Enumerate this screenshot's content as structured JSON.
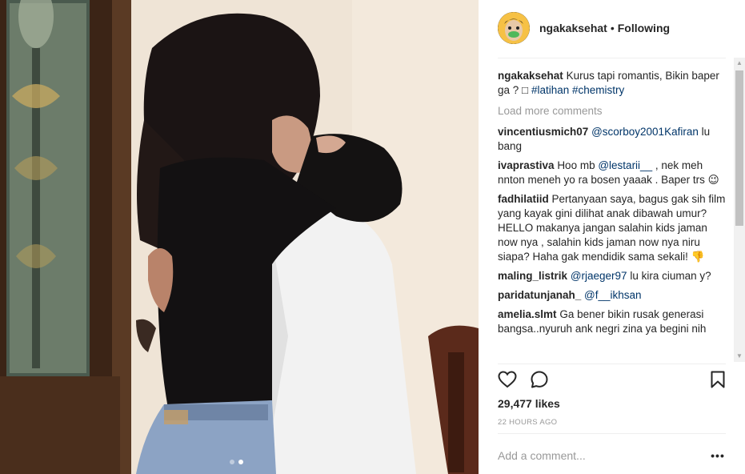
{
  "post": {
    "username": "ngakaksehat",
    "separator": "•",
    "follow_status": "Following",
    "caption": {
      "user": "ngakaksehat",
      "text": "Kurus tapi romantis, Bikin baper ga ? □ ",
      "hashtag1": "#latihan",
      "hashtag2": "#chemistry"
    },
    "load_more": "Load more comments",
    "comments": [
      {
        "user": "vincentiusmich07",
        "mention": "@scorboy2001Kafiran",
        "text_after": " lu bang"
      },
      {
        "user": "ivaprastiva",
        "text_before": "Hoo mb ",
        "mention": "@lestarii__",
        "text_after": " , nek meh nnton meneh yo ra bosen yaaak . Baper trs 😉"
      },
      {
        "user": "fadhilatiid",
        "text": "Pertanyaan saya, bagus gak sih film yang kayak gini dilihat anak dibawah umur? HELLO makanya jangan salahin kids jaman now nya , salahin kids jaman now nya niru siapa? Haha gak mendidik sama sekali! 👎"
      },
      {
        "user": "maling_listrik",
        "mention": "@rjaeger97",
        "text_after": " lu kira ciuman y?"
      },
      {
        "user": "paridatunjanah_",
        "mention": "@f__ikhsan"
      },
      {
        "user": "amelia.slmt",
        "text": "Ga bener bikin rusak generasi bangsa..nyuruh ank negri zina ya begini nih"
      }
    ],
    "likes": "29,477 likes",
    "time": "22 HOURS AGO",
    "add_comment_placeholder": "Add a comment...",
    "more_options": "•••"
  },
  "icons": {
    "like": "heart-icon",
    "comment": "comment-bubble-icon",
    "save": "bookmark-icon",
    "more": "more-options-icon",
    "scroll_up": "scroll-up-arrow-icon",
    "scroll_down": "scroll-down-arrow-icon"
  },
  "colors": {
    "text": "#262626",
    "muted": "#999999",
    "mention": "#003569",
    "divider": "#efefef"
  },
  "carousel": {
    "count": 2,
    "active_index": 1
  }
}
